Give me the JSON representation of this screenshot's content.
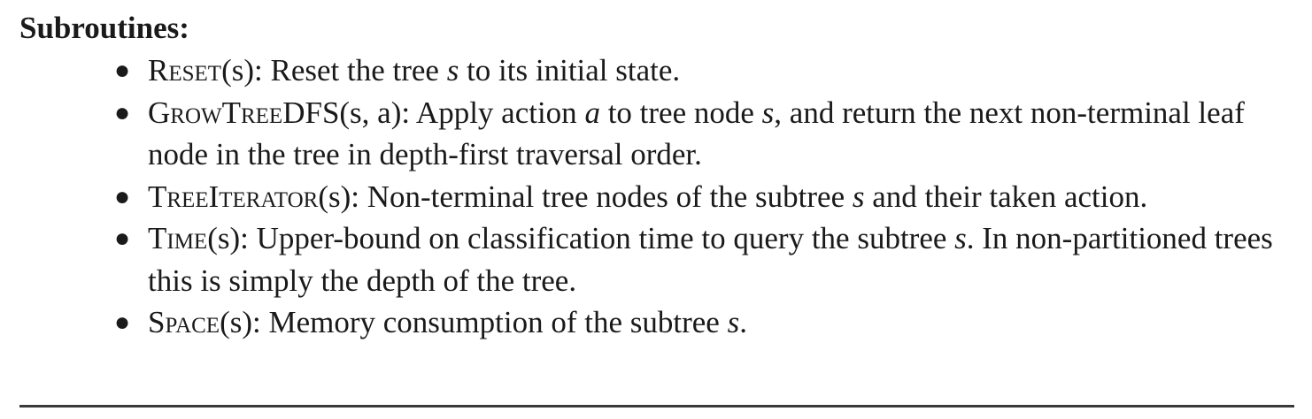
{
  "heading": "Subroutines:",
  "items": [
    {
      "name": "Reset",
      "args": "(s)",
      "parts": [
        ": Reset the tree ",
        "s",
        " to its initial state."
      ]
    },
    {
      "name": "GrowTreeDFS",
      "args": "(s, a)",
      "parts": [
        ": Apply action ",
        "a",
        " to tree node ",
        "s",
        ", and return the next non-terminal leaf node in the tree in depth-first traversal order."
      ]
    },
    {
      "name": "TreeIterator",
      "args": "(s)",
      "parts": [
        ": Non-terminal tree nodes of the subtree ",
        "s",
        " and their taken action."
      ]
    },
    {
      "name": "Time",
      "args": "(s)",
      "parts": [
        ": Upper-bound on classification time to query the subtree ",
        "s",
        ". In non-partitioned trees this is simply the depth of the tree."
      ]
    },
    {
      "name": "Space",
      "args": "(s)",
      "parts": [
        ": Memory consumption of the subtree ",
        "s",
        "."
      ]
    }
  ]
}
